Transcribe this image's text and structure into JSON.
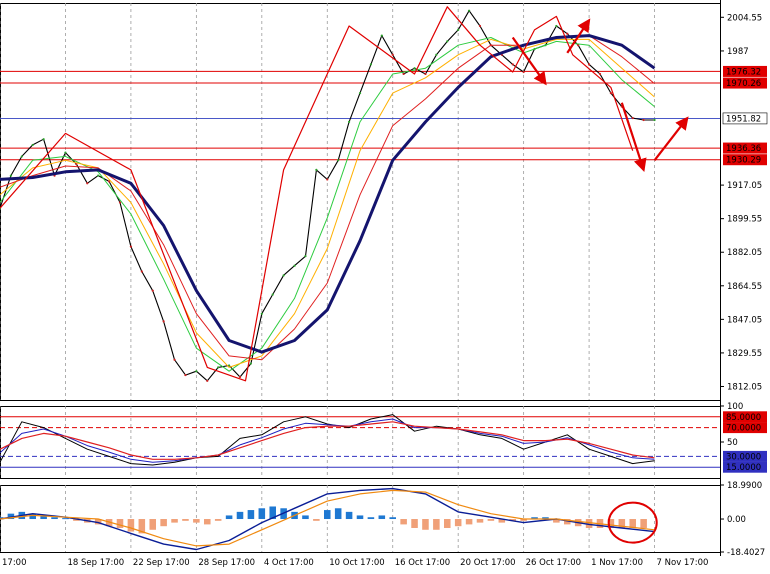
{
  "chart_data": [
    {
      "type": "line",
      "panel": "price",
      "ylim": [
        1805,
        2012
      ],
      "yticks": [
        2004.55,
        1987.0,
        1917.05,
        1899.55,
        1882.05,
        1864.55,
        1847.05,
        1829.55,
        1812.05
      ],
      "current_price": 1951.82,
      "levels": [
        {
          "label": "1976.32",
          "value": 1976.32,
          "color": "#e00000"
        },
        {
          "label": "1970.26",
          "value": 1970.26,
          "color": "#e00000"
        },
        {
          "label": "1936.36",
          "value": 1936.36,
          "color": "#e00000"
        },
        {
          "label": "1930.29",
          "value": 1930.29,
          "color": "#e00000"
        }
      ],
      "current_line_color": "#3040c0",
      "series": [
        {
          "role": "close",
          "color": "#000000",
          "x": [
            0,
            2,
            4,
            6,
            8,
            10,
            12,
            14,
            16,
            18,
            20,
            22,
            24,
            26,
            28,
            30,
            32,
            34,
            36,
            38,
            40,
            42,
            44,
            46,
            48,
            50,
            52,
            54,
            56,
            58,
            60,
            62,
            64,
            66,
            68,
            70,
            72,
            74,
            76,
            78,
            80,
            82,
            84,
            86,
            88,
            90,
            92,
            94,
            96,
            98,
            100,
            102,
            104,
            106,
            108,
            110,
            112,
            114,
            116,
            118,
            120
          ],
          "values": [
            1905,
            1922,
            1932,
            1938,
            1941,
            1922,
            1934,
            1928,
            1918,
            1922,
            1919,
            1908,
            1885,
            1872,
            1862,
            1846,
            1826,
            1818,
            1820,
            1815,
            1822,
            1823,
            1817,
            1824,
            1850,
            1860,
            1870,
            1875,
            1880,
            1925,
            1920,
            1930,
            1950,
            1965,
            1980,
            1995,
            1985,
            1975,
            1978,
            1975,
            1985,
            1992,
            1998,
            2008,
            2000,
            1990,
            1985,
            1980,
            1976,
            1988,
            1990,
            2000,
            1996,
            1990,
            1980,
            1975,
            1965,
            1958,
            1952,
            1951,
            1951
          ]
        },
        {
          "role": "ma-fast",
          "color": "#2ecc40",
          "x": [
            0,
            6,
            12,
            18,
            24,
            30,
            36,
            42,
            48,
            54,
            60,
            66,
            72,
            78,
            84,
            90,
            96,
            102,
            108,
            114,
            120
          ],
          "values": [
            1908,
            1930,
            1932,
            1924,
            1902,
            1868,
            1832,
            1820,
            1832,
            1858,
            1900,
            1950,
            1975,
            1978,
            1990,
            1994,
            1986,
            1992,
            1990,
            1972,
            1958
          ]
        },
        {
          "role": "ma-mid",
          "color": "#ffb000",
          "x": [
            0,
            6,
            12,
            18,
            24,
            30,
            36,
            42,
            48,
            54,
            60,
            66,
            72,
            78,
            84,
            90,
            96,
            102,
            108,
            114,
            120
          ],
          "values": [
            1912,
            1926,
            1930,
            1926,
            1908,
            1876,
            1840,
            1822,
            1828,
            1850,
            1884,
            1935,
            1965,
            1973,
            1985,
            1993,
            1988,
            1993,
            1993,
            1978,
            1963
          ]
        },
        {
          "role": "ma-slow",
          "color": "#e02020",
          "x": [
            0,
            6,
            12,
            18,
            24,
            30,
            36,
            42,
            48,
            54,
            60,
            66,
            72,
            78,
            84,
            90,
            96,
            102,
            108,
            114,
            120
          ],
          "values": [
            1916,
            1922,
            1927,
            1926,
            1914,
            1886,
            1850,
            1828,
            1826,
            1842,
            1866,
            1912,
            1948,
            1962,
            1978,
            1990,
            1990,
            1994,
            1995,
            1984,
            1970
          ]
        },
        {
          "role": "ma-base",
          "color": "#14146e",
          "x": [
            0,
            6,
            12,
            18,
            24,
            30,
            36,
            42,
            48,
            54,
            60,
            66,
            72,
            78,
            84,
            90,
            96,
            102,
            108,
            114,
            120
          ],
          "values": [
            1920,
            1921,
            1924,
            1925,
            1918,
            1896,
            1862,
            1836,
            1830,
            1836,
            1852,
            1888,
            1930,
            1950,
            1968,
            1984,
            1990,
            1994,
            1995,
            1990,
            1978
          ]
        },
        {
          "role": "zigzag",
          "color": "#e00000",
          "x": [
            0,
            12,
            24,
            38,
            45,
            52,
            64,
            76,
            82,
            88,
            94,
            98,
            102,
            105,
            112,
            116
          ],
          "values": [
            1905,
            1944,
            1925,
            1822,
            1815,
            1925,
            2000,
            1975,
            2010,
            1990,
            1976,
            1998,
            2005,
            1985,
            1968,
            1935
          ]
        }
      ]
    },
    {
      "type": "line",
      "panel": "oscillator",
      "ylim": [
        0,
        100
      ],
      "yticks": [
        100,
        50
      ],
      "levels": [
        {
          "label": "85.0000",
          "value": 85,
          "color": "#e00000"
        },
        {
          "label": "70.0000",
          "value": 70,
          "color": "#e00000"
        },
        {
          "label": "30.0000",
          "value": 30,
          "color": "#3030c0"
        },
        {
          "label": "15.0000",
          "value": 15,
          "color": "#3030c0"
        }
      ],
      "series": [
        {
          "role": "k",
          "color": "#000000",
          "x": [
            0,
            4,
            8,
            12,
            16,
            20,
            24,
            28,
            32,
            36,
            40,
            44,
            48,
            52,
            56,
            60,
            64,
            68,
            72,
            76,
            80,
            84,
            88,
            92,
            96,
            100,
            104,
            108,
            112,
            116,
            120
          ],
          "values": [
            22,
            78,
            70,
            55,
            40,
            30,
            20,
            18,
            22,
            28,
            30,
            55,
            60,
            78,
            85,
            75,
            70,
            82,
            88,
            65,
            72,
            68,
            60,
            55,
            40,
            50,
            60,
            40,
            30,
            20,
            24
          ]
        },
        {
          "role": "d",
          "color": "#2020c0",
          "x": [
            0,
            4,
            8,
            12,
            16,
            20,
            24,
            28,
            32,
            36,
            40,
            44,
            48,
            52,
            56,
            60,
            64,
            68,
            72,
            76,
            80,
            84,
            88,
            92,
            96,
            100,
            104,
            108,
            112,
            116,
            120
          ],
          "values": [
            35,
            62,
            68,
            58,
            45,
            36,
            26,
            22,
            24,
            28,
            32,
            46,
            56,
            68,
            76,
            74,
            72,
            78,
            82,
            70,
            70,
            68,
            62,
            58,
            48,
            50,
            56,
            46,
            36,
            28,
            26
          ]
        },
        {
          "role": "signal",
          "color": "#e02020",
          "x": [
            0,
            4,
            8,
            12,
            16,
            20,
            24,
            28,
            32,
            36,
            40,
            44,
            48,
            52,
            56,
            60,
            64,
            68,
            72,
            76,
            80,
            84,
            88,
            92,
            96,
            100,
            104,
            108,
            112,
            116,
            120
          ],
          "values": [
            40,
            55,
            62,
            58,
            50,
            42,
            32,
            26,
            26,
            28,
            32,
            42,
            52,
            62,
            70,
            72,
            72,
            75,
            78,
            72,
            70,
            68,
            64,
            60,
            52,
            52,
            54,
            48,
            40,
            32,
            28
          ]
        }
      ]
    },
    {
      "type": "bar",
      "panel": "macd",
      "ylim": [
        -18.4027,
        18.99
      ],
      "yticks": [
        18.99,
        0.0,
        -18.4027
      ],
      "ytick_labels": [
        "18.9900",
        "0.00",
        "-18.4027"
      ],
      "histogram_positive_color": "#1e78d2",
      "histogram_negative_color": "#f0a078",
      "histogram": {
        "x": [
          0,
          2,
          4,
          6,
          8,
          10,
          12,
          14,
          16,
          18,
          20,
          22,
          24,
          26,
          28,
          30,
          32,
          34,
          36,
          38,
          40,
          42,
          44,
          46,
          48,
          50,
          52,
          54,
          56,
          58,
          60,
          62,
          64,
          66,
          68,
          70,
          72,
          74,
          76,
          78,
          80,
          82,
          84,
          86,
          88,
          90,
          92,
          94,
          96,
          98,
          100,
          102,
          104,
          106,
          108,
          110,
          112,
          114,
          116,
          118
        ],
        "values": [
          1,
          3,
          4,
          3,
          2,
          1,
          0.5,
          -1,
          -2,
          -3,
          -4,
          -5,
          -7,
          -8,
          -6,
          -4,
          -2,
          -1,
          -2,
          -3,
          -1,
          2,
          4,
          5,
          6,
          7,
          6,
          4,
          2,
          -1,
          5,
          6,
          4,
          2,
          1,
          2,
          1,
          -3,
          -5,
          -6,
          -6,
          -5,
          -4,
          -3,
          -2,
          -1,
          -2,
          -1,
          -1,
          1,
          1,
          -2,
          -3,
          -4,
          -5,
          -5,
          -5,
          -5,
          -5,
          -5
        ]
      },
      "series": [
        {
          "role": "macd",
          "color": "#0a1e96",
          "x": [
            0,
            6,
            12,
            18,
            24,
            30,
            36,
            42,
            48,
            54,
            60,
            66,
            72,
            78,
            84,
            90,
            96,
            102,
            108,
            114,
            120
          ],
          "values": [
            0,
            3,
            1,
            -2,
            -8,
            -14,
            -17,
            -12,
            -2,
            6,
            14,
            16,
            17,
            14,
            4,
            1,
            -2,
            0,
            -3,
            -5,
            -7
          ]
        },
        {
          "role": "signal",
          "color": "#f08a10",
          "x": [
            0,
            6,
            12,
            18,
            24,
            30,
            36,
            42,
            48,
            54,
            60,
            66,
            72,
            78,
            84,
            90,
            96,
            102,
            108,
            114,
            120
          ],
          "values": [
            0,
            2,
            1,
            0,
            -5,
            -11,
            -15,
            -14,
            -6,
            2,
            10,
            14,
            16,
            15,
            8,
            3,
            0,
            0,
            -2,
            -4,
            -6
          ]
        }
      ]
    }
  ],
  "x_axis": {
    "domain": [
      0,
      132
    ],
    "ticks": [
      {
        "x": 0,
        "label": "17:00"
      },
      {
        "x": 12,
        "label": "18 Sep 17:00"
      },
      {
        "x": 24,
        "label": "22 Sep 17:00"
      },
      {
        "x": 36,
        "label": "28 Sep 17:00"
      },
      {
        "x": 48,
        "label": "4 Oct 17:00"
      },
      {
        "x": 60,
        "label": "10 Oct 17:00"
      },
      {
        "x": 72,
        "label": "16 Oct 17:00"
      },
      {
        "x": 84,
        "label": "20 Oct 17:00"
      },
      {
        "x": 96,
        "label": "26 Oct 17:00"
      },
      {
        "x": 108,
        "label": "1 Nov 17:00"
      },
      {
        "x": 120,
        "label": "7 Nov 17:00"
      }
    ]
  },
  "current_price_label": "1951.82",
  "colors": {
    "grid": "#9a9a9a",
    "axis": "#000000",
    "arrow": "#e00000"
  }
}
